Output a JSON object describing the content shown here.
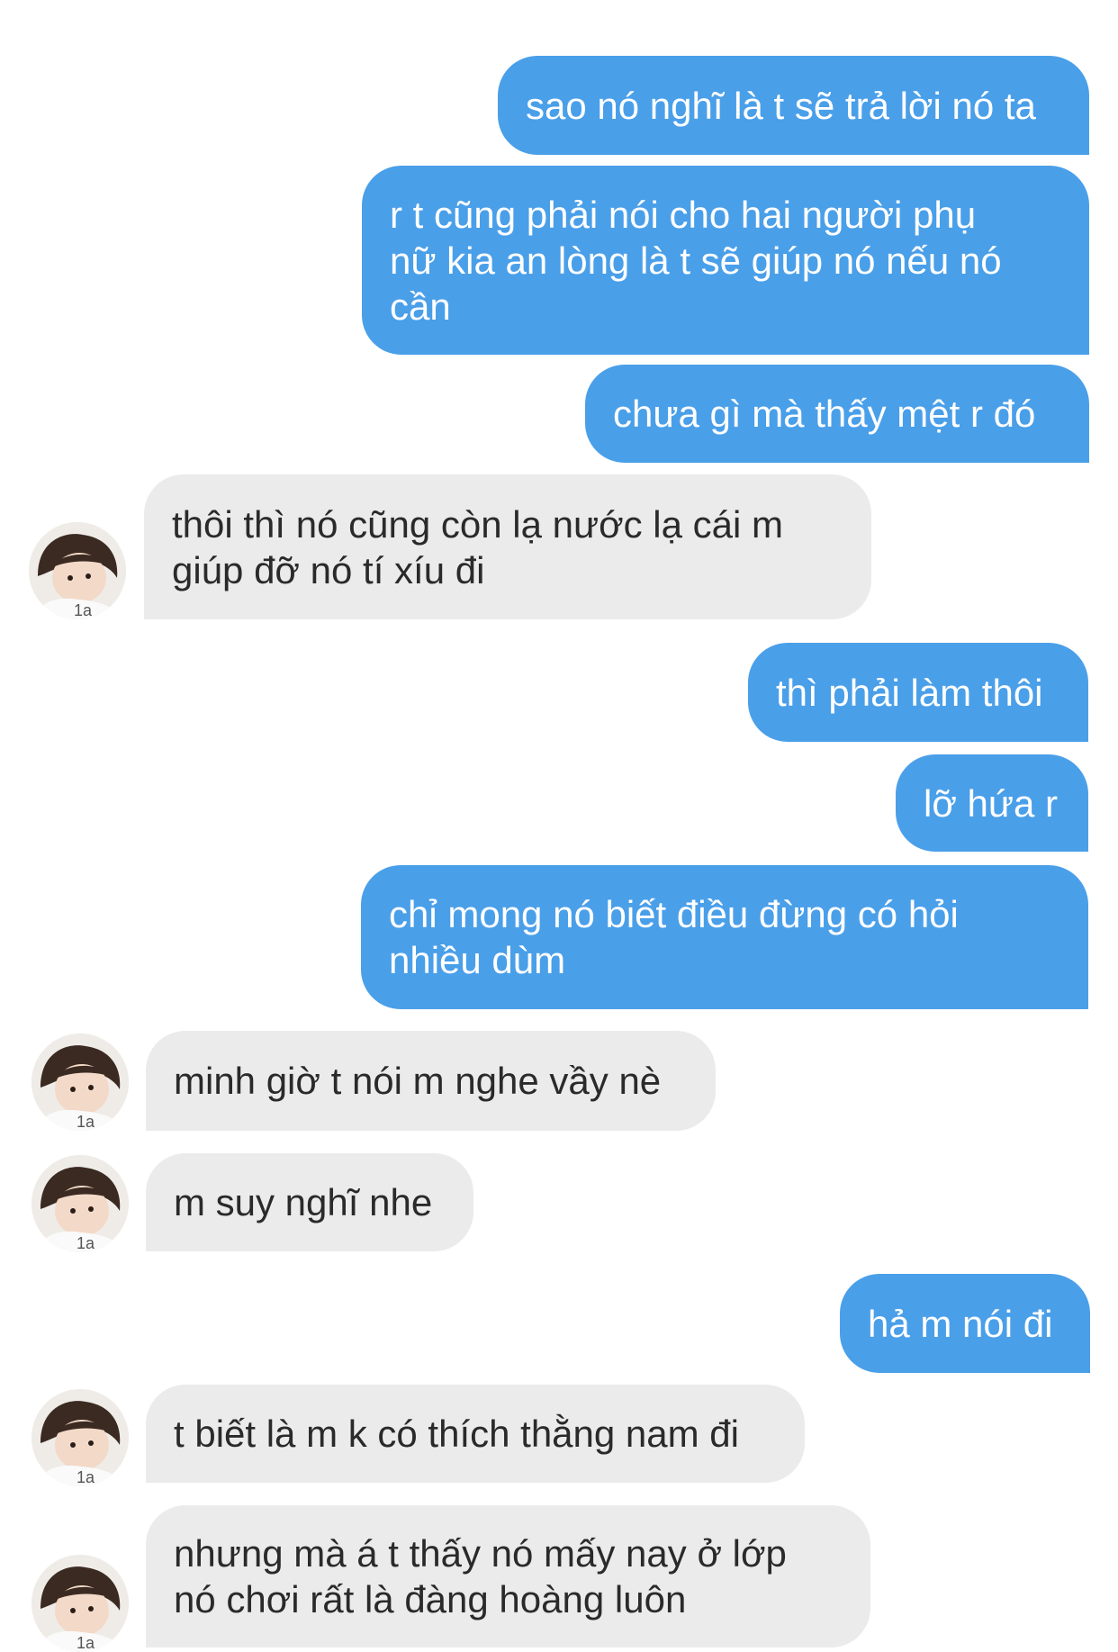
{
  "messages": [
    {
      "sender": "me",
      "text": "sao nó nghĩ là t sẽ trả lời nó ta"
    },
    {
      "sender": "me",
      "text": "r t cũng phải nói cho hai người phụ\nnữ kia an lòng là t sẽ giúp nó nếu nó\ncần"
    },
    {
      "sender": "me",
      "text": "chưa gì mà thấy mệt r đó"
    },
    {
      "sender": "them",
      "text": "thôi thì nó cũng còn lạ nước lạ cái m\ngiúp đỡ nó tí xíu đi"
    },
    {
      "sender": "me",
      "text": "thì phải làm thôi"
    },
    {
      "sender": "me",
      "text": "lỡ hứa r"
    },
    {
      "sender": "me",
      "text": "chỉ mong nó biết điều đừng có hỏi\nnhiều dùm"
    },
    {
      "sender": "them",
      "text": "minh giờ t nói m nghe vầy nè"
    },
    {
      "sender": "them",
      "text": "m suy nghĩ nhe"
    },
    {
      "sender": "me",
      "text": "hả m nói đi"
    },
    {
      "sender": "them",
      "text": "t biết là m k có thích thằng nam đi"
    },
    {
      "sender": "them",
      "text": "nhưng mà á t thấy nó mấy nay ở lớp\nnó chơi rất là đàng hoàng luôn"
    }
  ],
  "colors": {
    "sent_bubble": "#4a9fe9",
    "received_bubble": "#ebebeb"
  },
  "icons": {
    "contact_avatar": "profile-photo"
  }
}
